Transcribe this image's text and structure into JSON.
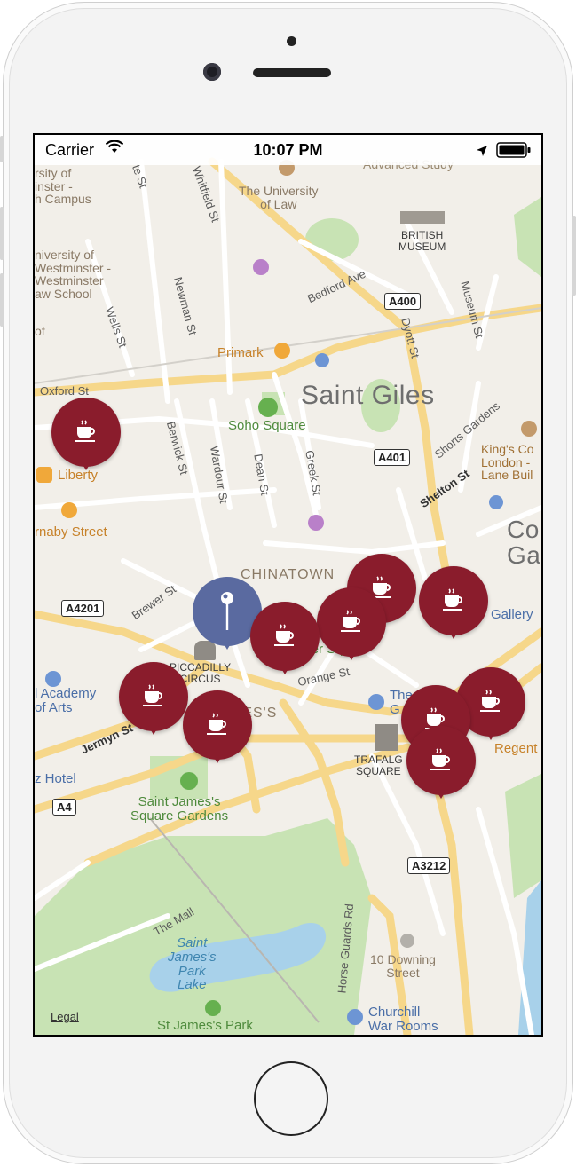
{
  "status_bar": {
    "carrier": "Carrier",
    "time": "10:07 PM"
  },
  "map": {
    "districts": [
      "Saint Giles"
    ],
    "labels": {
      "univ_top": "rsity of\ninster -\nh Campus",
      "univ_law": "The University\nof Law",
      "british_museum": "BRITISH\nMUSEUM",
      "univ_westminster": "niversity of\nWestminster -\nWestminster\naw School",
      "of": "of",
      "primark": "Primark",
      "soho_square": "Soho Square",
      "liberty": "Liberty",
      "carnaby": "rnaby Street",
      "chinatown": "CHINATOWN",
      "kings_college": "King's Co\nLondon -\nLane Buil",
      "covent": "Co\nGa",
      "gallery": "Gallery",
      "piccadilly": "PICCADILLY\nCIRCUS",
      "james": "MES'S",
      "academy": "l Academy\nof Arts",
      "the_g": "The\nG",
      "trafalgar": "TRAFALG\nSQUARE",
      "regent": "Regent",
      "hotel": "z Hotel",
      "st_james_square": "Saint James's\nSquare Gardens",
      "st_james_park_lake": "Saint\nJames's\nPark\nLake",
      "st_james_park": "St James's Park",
      "downing": "10 Downing\nStreet",
      "churchill": "Churchill\nWar Rooms",
      "advanced": "Advanced Study",
      "leicester": "ster Sq"
    },
    "roads": {
      "whitfield": "Whitfield St",
      "bedford": "Bedford Ave",
      "museum": "Museum St",
      "newman": "Newman St",
      "wells": "Wells St",
      "oxford": "Oxford St",
      "dyott": "Dyott St",
      "berwick": "Berwick St",
      "wardour": "Wardour St",
      "dean": "Dean St",
      "greek": "Greek St",
      "shorts": "Shorts Gardens",
      "shelton": "Shelton St",
      "brewer": "Brewer St",
      "orange": "Orange St",
      "jermyn": "Jermyn St",
      "the_mall": "The Mall",
      "horse_guards": "Horse Guards Rd",
      "te_st": "te St"
    },
    "road_badges": [
      "A400",
      "A401",
      "A4201",
      "A4",
      "A3212"
    ],
    "legal": "Legal",
    "markers_count": 11
  },
  "colors": {
    "marker": "#8a1c2c",
    "user_pin": "#5a6aa0",
    "park": "#c8e3b4",
    "water": "#a8d1ea"
  }
}
